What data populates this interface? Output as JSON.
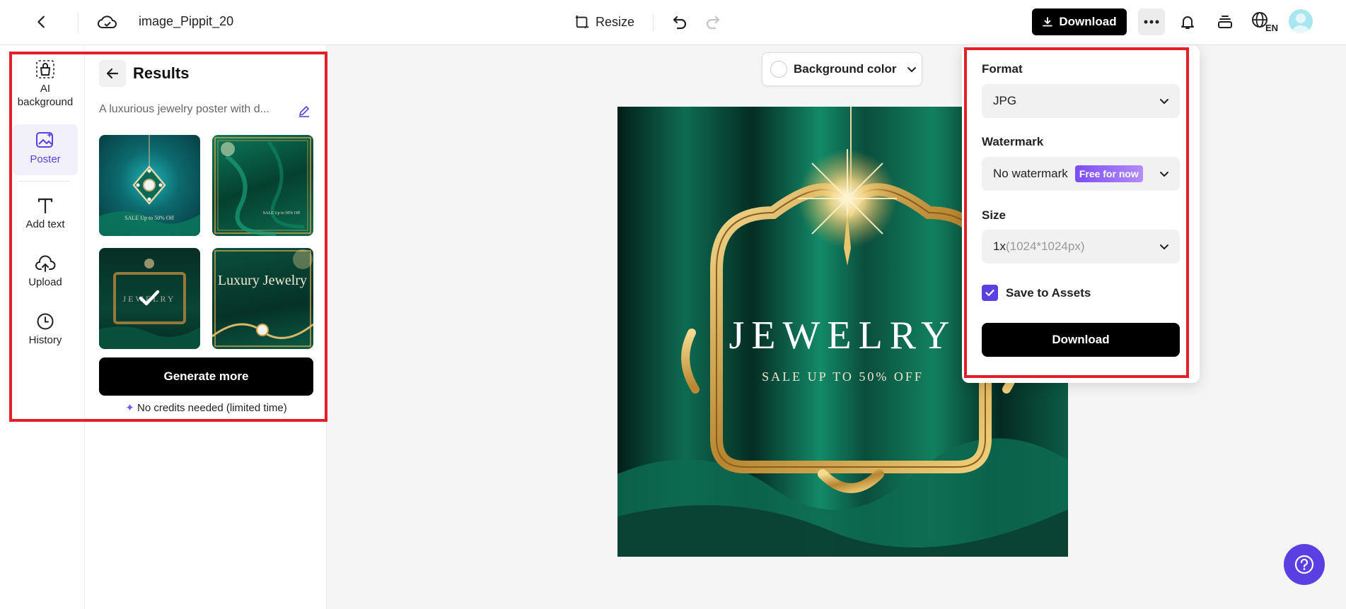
{
  "header": {
    "title": "image_Pippit_20",
    "resize_label": "Resize",
    "download_label": "Download",
    "lang_label": "EN"
  },
  "rail": {
    "items": [
      {
        "label": "AI background",
        "icon": "bag-icon"
      },
      {
        "label": "Poster",
        "icon": "poster-icon",
        "active": true
      },
      {
        "label": "Add text",
        "icon": "text-icon"
      },
      {
        "label": "Upload",
        "icon": "upload-cloud-icon"
      },
      {
        "label": "History",
        "icon": "clock-icon"
      }
    ]
  },
  "results": {
    "title": "Results",
    "prompt": "A luxurious jewelry poster with d...",
    "thumbnails": [
      {
        "caption": "SALE Up to 50% Off"
      },
      {
        "caption": "SALE Up to 50% Off"
      },
      {
        "caption": "JEWELRY",
        "selected": true
      },
      {
        "caption": "Luxury Jewelry"
      }
    ],
    "generate_label": "Generate more",
    "credits_note": "No credits needed (limited time)"
  },
  "canvas": {
    "bg_color_label": "Background color",
    "poster_title": "JEWELRY",
    "poster_subtitle": "SALE UP TO 50% OFF"
  },
  "download_panel": {
    "format_label": "Format",
    "format_value": "JPG",
    "watermark_label": "Watermark",
    "watermark_value": "No watermark",
    "watermark_badge": "Free for now",
    "size_label": "Size",
    "size_value": "1x",
    "size_detail": "(1024*1024px)",
    "save_label": "Save to Assets",
    "save_checked": true,
    "download_label": "Download"
  },
  "colors": {
    "accent": "#5b3fe0",
    "annotation": "#e3202a",
    "poster_green": "#0d5c48"
  }
}
